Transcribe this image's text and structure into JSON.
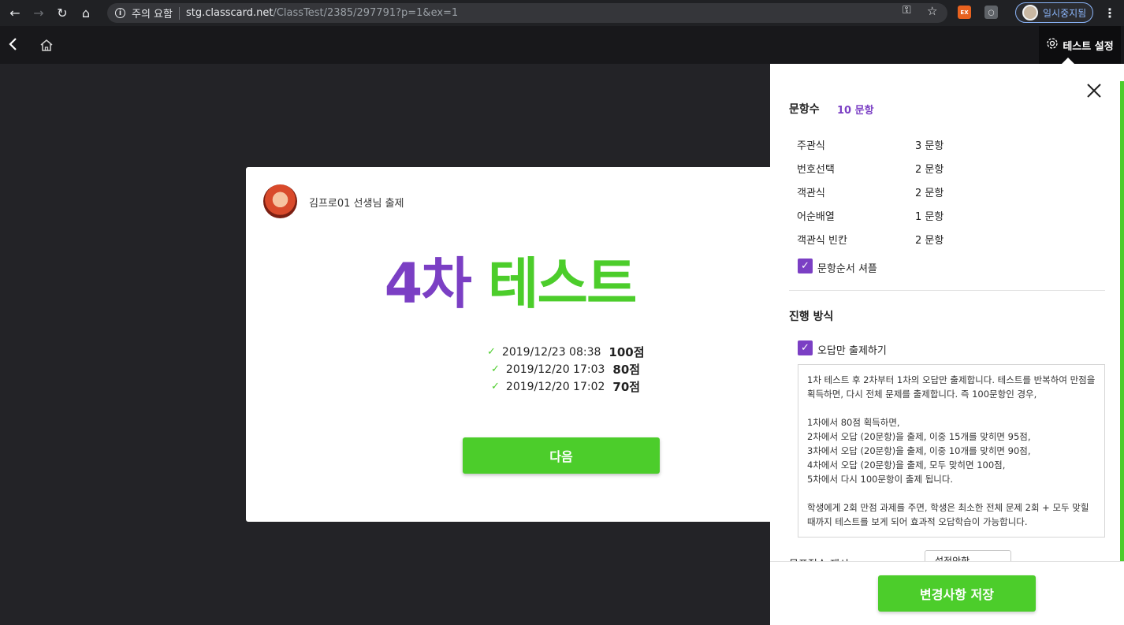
{
  "browser": {
    "security_label": "주의 요함",
    "url_host": "stg.classcard.net",
    "url_path": "/ClassTest/2385/297791?p=1&ex=1",
    "profile_label": "일시중지됨",
    "ext1_label": "EX"
  },
  "header": {
    "settings_label": "테스트 설정"
  },
  "card": {
    "teacher_name": "김프로01 선생님 출제",
    "title_number": "4차",
    "title_word": "테스트",
    "history": [
      {
        "date": "2019/12/23 08:38",
        "score": "100점"
      },
      {
        "date": "2019/12/20 17:03",
        "score": "80점"
      },
      {
        "date": "2019/12/20 17:02",
        "score": "70점"
      }
    ],
    "next_label": "다음"
  },
  "panel": {
    "q_count_label": "문항수",
    "q_count_value": "10 문항",
    "question_types": [
      {
        "name": "주관식",
        "count": "3 문항"
      },
      {
        "name": "번호선택",
        "count": "2 문항"
      },
      {
        "name": "객관식",
        "count": "2 문항"
      },
      {
        "name": "어순배열",
        "count": "1 문항"
      },
      {
        "name": "객관식 빈칸",
        "count": "2 문항"
      }
    ],
    "shuffle_label": "문항순서 셔플",
    "shuffle_checked": true,
    "progress_title": "진행 방식",
    "wrong_only_label": "오답만 출제하기",
    "wrong_only_checked": true,
    "description": {
      "p1": "1차 테스트 후 2차부터 1차의 오답만 출제합니다. 테스트를 반복하여 만점을 획득하면, 다시 전체 문제를 출제합니다. 즉 100문항인 경우,",
      "l1": "1차에서 80점 획득하면,",
      "l2": "2차에서 오답 (20문항)을 출제, 이중 15개를 맞히면 95점,",
      "l3": "3차에서 오답 (20문항)을 출제, 이중 10개를 맞히면 90점,",
      "l4": "4차에서 오답 (20문항)을 출제, 모두 맞히면 100점,",
      "l5": "5차에서 다시 100문항이 출제 됩니다.",
      "p3": "학생에게 2회 만점 과제를 주면, 학생은 최소한 전체 문제 2회 + 모두 맞힐 때까지 테스트를 보게 되어 효과적 오답학습이 가능합니다."
    },
    "partial_label": "목표점수 제시",
    "partial_select": "설정안함",
    "save_label": "변경사항 저장"
  },
  "colors": {
    "purple": "#7b3fc4",
    "green": "#4ccd2b"
  }
}
